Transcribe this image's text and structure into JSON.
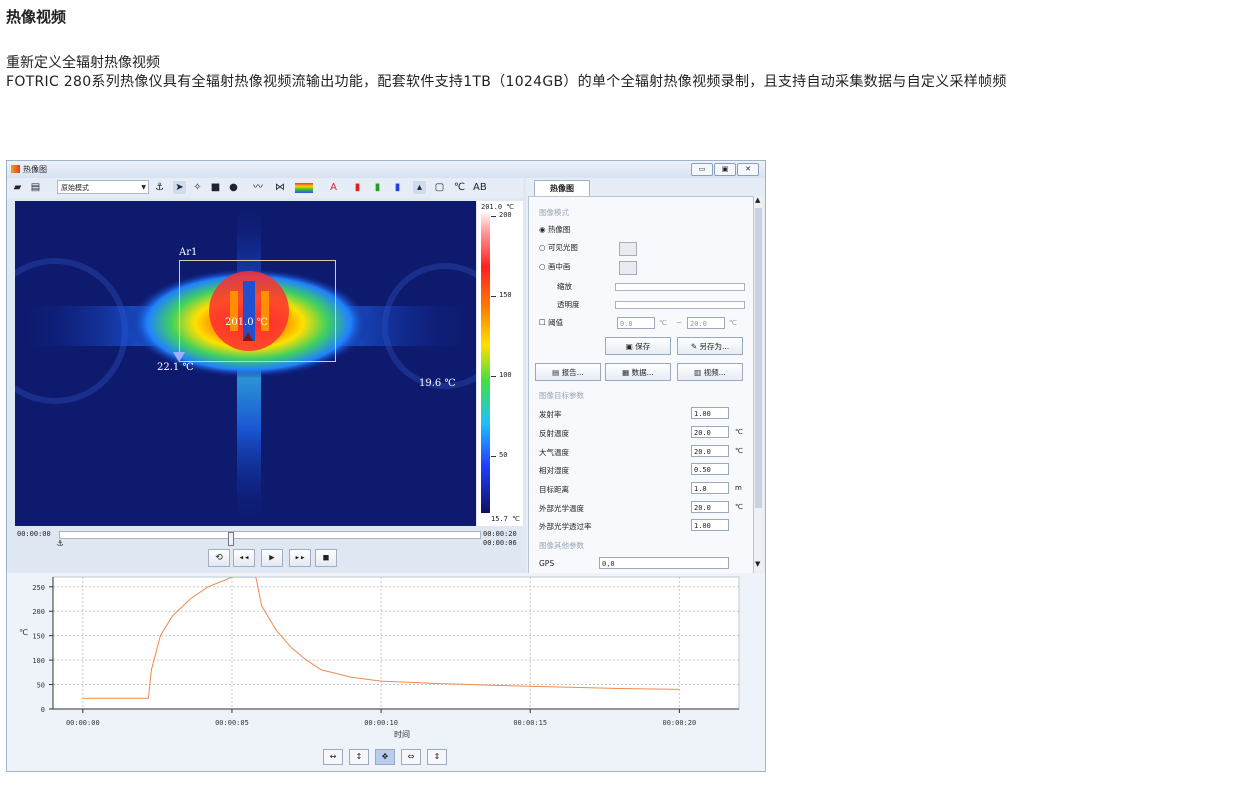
{
  "article": {
    "title": "热像视频",
    "subtitle": "重新定义全辐射热像视频",
    "body": "FOTRIC 280系列热像仪具有全辐射热像视频流输出功能，配套软件支持1TB（1024GB）的单个全辐射热像视频录制，且支持自动采集数据与自定义采样帧频"
  },
  "window": {
    "title": "热像图"
  },
  "toolbar": {
    "mode_select": "原始模式"
  },
  "thermal": {
    "roi_label": "Ar1",
    "max_temp": "201.0 ℃",
    "min_temp": "22.1 ℃",
    "spot_temp": "19.6 ℃"
  },
  "scale": {
    "top": "201.0 ℃",
    "bottom": "15.7 ℃",
    "ticks": [
      "200",
      "150",
      "100",
      "50"
    ]
  },
  "timeline": {
    "start": "00:00:00",
    "end": "00:00:20",
    "current": "00:00:06"
  },
  "panel": {
    "tab": "热像图",
    "section_image_mode": "图像模式",
    "radio_thermal": "热像图",
    "radio_visible": "可见光图",
    "radio_pip": "画中画",
    "zoom_label": "缩放",
    "opacity_label": "透明度",
    "threshold_label": "阈值",
    "threshold_low": "0.0",
    "threshold_high": "20.0",
    "threshold_sep": "~",
    "save": "保存",
    "save_as": "另存为...",
    "report": "报告...",
    "data": "数据...",
    "video": "视频...",
    "section_target": "图像目标参数",
    "params": [
      {
        "label": "发射率",
        "value": "1.00",
        "unit": ""
      },
      {
        "label": "反射温度",
        "value": "20.0",
        "unit": "℃"
      },
      {
        "label": "大气温度",
        "value": "20.0",
        "unit": "℃"
      },
      {
        "label": "相对湿度",
        "value": "0.50",
        "unit": ""
      },
      {
        "label": "目标距离",
        "value": "1.0",
        "unit": "m"
      },
      {
        "label": "外部光学温度",
        "value": "20.0",
        "unit": "℃"
      },
      {
        "label": "外部光学透过率",
        "value": "1.00",
        "unit": ""
      }
    ],
    "section_other": "图像其他参数",
    "gps_label": "GPS",
    "gps_value": "0,0",
    "celsius": "℃"
  },
  "chart_data": {
    "type": "line",
    "ylabel": "℃",
    "xlabel": "时间",
    "ylim": [
      0,
      270
    ],
    "yticks": [
      0,
      50,
      100,
      150,
      200,
      250
    ],
    "xticks": [
      "00:00:00",
      "00:00:05",
      "00:00:10",
      "00:00:15",
      "00:00:20"
    ],
    "series": [
      {
        "color": "#f08a4b",
        "x": [
          0,
          2.2,
          2.3,
          2.6,
          3.0,
          3.6,
          4.2,
          4.7,
          5.0,
          5.8,
          6.0,
          6.5,
          7.0,
          7.5,
          8.0,
          9.0,
          10.0,
          12.0,
          14.0,
          16.0,
          18.0,
          20.0
        ],
        "y": [
          22,
          22,
          80,
          150,
          190,
          225,
          250,
          262,
          270,
          270,
          210,
          160,
          125,
          100,
          80,
          65,
          57,
          52,
          48,
          45,
          42,
          40
        ]
      }
    ],
    "xlim": [
      -1,
      22
    ]
  }
}
